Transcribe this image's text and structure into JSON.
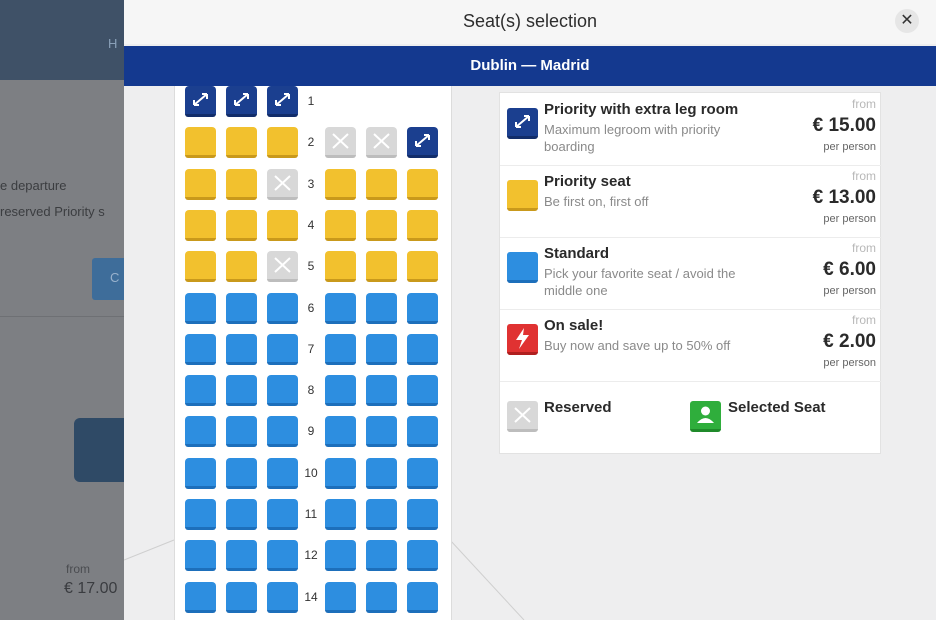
{
  "background": {
    "header_fragment": "H",
    "line1": "e departure",
    "line2": "reserved Priority s",
    "button_fragment": "C",
    "from_label": "from",
    "price": "€ 17.00"
  },
  "modal": {
    "title": "Seat(s) selection",
    "close_symbol": "✕",
    "route": "Dublin — Madrid"
  },
  "seat_map": {
    "rows": [
      {
        "num": "1",
        "seats": [
          "navy",
          "navy",
          "navy",
          null,
          null,
          null
        ]
      },
      {
        "num": "2",
        "seats": [
          "yellow",
          "yellow",
          "yellow",
          "reserved",
          "reserved",
          "navy"
        ]
      },
      {
        "num": "3",
        "seats": [
          "yellow",
          "yellow",
          "reserved",
          "yellow",
          "yellow",
          "yellow"
        ]
      },
      {
        "num": "4",
        "seats": [
          "yellow",
          "yellow",
          "yellow",
          "yellow",
          "yellow",
          "yellow"
        ]
      },
      {
        "num": "5",
        "seats": [
          "yellow",
          "yellow",
          "reserved",
          "yellow",
          "yellow",
          "yellow"
        ]
      },
      {
        "num": "6",
        "seats": [
          "blue",
          "blue",
          "blue",
          "blue",
          "blue",
          "blue"
        ]
      },
      {
        "num": "7",
        "seats": [
          "blue",
          "blue",
          "blue",
          "blue",
          "blue",
          "blue"
        ]
      },
      {
        "num": "8",
        "seats": [
          "blue",
          "blue",
          "blue",
          "blue",
          "blue",
          "blue"
        ]
      },
      {
        "num": "9",
        "seats": [
          "blue",
          "blue",
          "blue",
          "blue",
          "blue",
          "blue"
        ]
      },
      {
        "num": "10",
        "seats": [
          "blue",
          "blue",
          "blue",
          "blue",
          "blue",
          "blue"
        ]
      },
      {
        "num": "11",
        "seats": [
          "blue",
          "blue",
          "blue",
          "blue",
          "blue",
          "blue"
        ]
      },
      {
        "num": "12",
        "seats": [
          "blue",
          "blue",
          "blue",
          "blue",
          "blue",
          "blue"
        ]
      },
      {
        "num": "14",
        "seats": [
          "blue",
          "blue",
          "blue",
          "blue",
          "blue",
          "blue"
        ]
      }
    ]
  },
  "legend": {
    "items": [
      {
        "title": "Priority with extra leg room",
        "desc": "Maximum legroom with priority boarding",
        "from": "from",
        "price": "€ 15.00",
        "per": "per person",
        "icon": "extra-legroom-icon"
      },
      {
        "title": "Priority seat",
        "desc": "Be first on, first off",
        "from": "from",
        "price": "€ 13.00",
        "per": "per person",
        "icon": "priority-seat-icon"
      },
      {
        "title": "Standard",
        "desc": "Pick your favorite seat / avoid the middle one",
        "from": "from",
        "price": "€ 6.00",
        "per": "per person",
        "icon": "standard-seat-icon"
      },
      {
        "title": "On sale!",
        "desc": "Buy now and save up to 50% off",
        "from": "from",
        "price": "€ 2.00",
        "per": "per person",
        "icon": "lightning-icon"
      }
    ],
    "reserved_label": "Reserved",
    "selected_label": "Selected Seat"
  },
  "colors": {
    "navy": "#1b3f8f",
    "yellow": "#f2c12e",
    "blue": "#2d8ee0",
    "reserved": "#d8d8d8",
    "sale": "#e03232",
    "selected": "#2fae3c",
    "route_bar": "#14398f"
  }
}
